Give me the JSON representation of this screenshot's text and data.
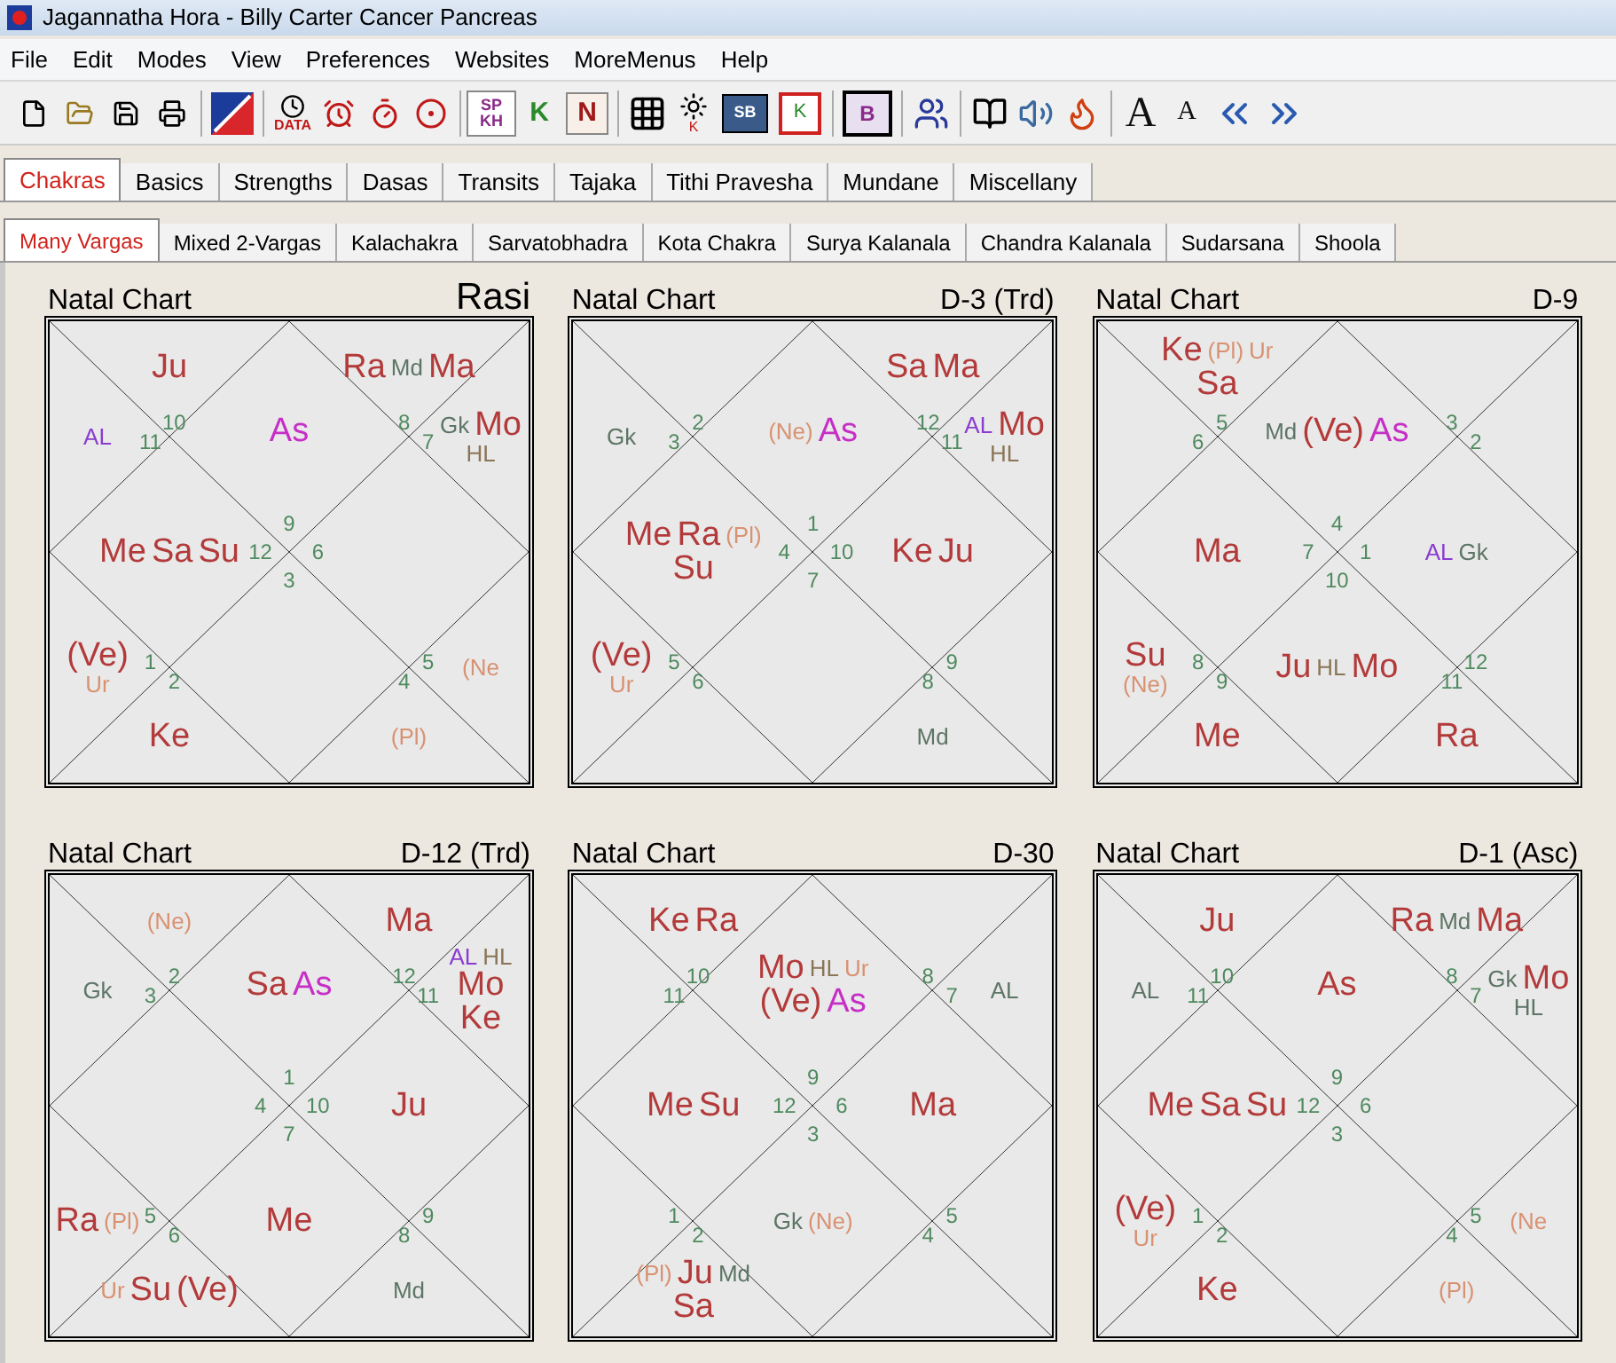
{
  "window": {
    "title": "Jagannatha Hora - Billy Carter Cancer Pancreas"
  },
  "menu": [
    "File",
    "Edit",
    "Modes",
    "View",
    "Preferences",
    "Websites",
    "MoreMenus",
    "Help"
  ],
  "toolbar_labels": {
    "data": "DATA",
    "sp": "SP",
    "kh": "KH",
    "key": "K",
    "n": "N",
    "star": "K",
    "sb": "SB",
    "box": "K",
    "b": "B",
    "a_large": "A",
    "a_small": "A"
  },
  "tabs": [
    {
      "label": "Chakras",
      "selected": true
    },
    {
      "label": "Basics",
      "selected": false
    },
    {
      "label": "Strengths",
      "selected": false
    },
    {
      "label": "Dasas",
      "selected": false
    },
    {
      "label": "Transits",
      "selected": false
    },
    {
      "label": "Tajaka",
      "selected": false
    },
    {
      "label": "Tithi Pravesha",
      "selected": false
    },
    {
      "label": "Mundane",
      "selected": false
    },
    {
      "label": "Miscellany",
      "selected": false
    }
  ],
  "subtabs": [
    {
      "label": "Many Vargas",
      "selected": true
    },
    {
      "label": "Mixed 2-Vargas",
      "selected": false
    },
    {
      "label": "Kalachakra",
      "selected": false
    },
    {
      "label": "Sarvatobhadra",
      "selected": false
    },
    {
      "label": "Kota Chakra",
      "selected": false
    },
    {
      "label": "Surya Kalanala",
      "selected": false
    },
    {
      "label": "Chandra Kalanala",
      "selected": false
    },
    {
      "label": "Sudarsana",
      "selected": false
    },
    {
      "label": "Shoola",
      "selected": false
    }
  ],
  "charts": [
    {
      "title": "Natal Chart",
      "varga": "Rasi",
      "houses": {
        "house_1": {
          "sign": "9",
          "planets": [
            {
              "name": "As",
              "kind": "lagna"
            }
          ]
        },
        "house_2": {
          "sign": "10",
          "planets": [
            {
              "name": "Ju",
              "kind": "graha"
            }
          ]
        },
        "house_3": {
          "sign": "11",
          "planets": [
            {
              "name": "AL",
              "kind": "arudha"
            }
          ]
        },
        "house_4": {
          "sign": "12",
          "planets": [
            {
              "name": "Me",
              "kind": "graha"
            },
            {
              "name": "Sa",
              "kind": "graha"
            },
            {
              "name": "Su",
              "kind": "graha"
            }
          ]
        },
        "house_5": {
          "sign": "1",
          "planets": [
            {
              "name": "(Ve)",
              "kind": "graha"
            },
            {
              "name": "Ur",
              "kind": "outer"
            }
          ]
        },
        "house_6": {
          "sign": "2",
          "planets": [
            {
              "name": "Ke",
              "kind": "graha"
            }
          ]
        },
        "house_7": {
          "sign": "3"
        },
        "house_8": {
          "sign": "4",
          "planets": [
            {
              "name": "(Pl)",
              "kind": "outer"
            }
          ]
        },
        "house_9": {
          "sign": "5",
          "planets": [
            {
              "name": "(Ne",
              "kind": "outer"
            }
          ]
        },
        "house_10": {
          "sign": "6"
        },
        "house_11": {
          "sign": "7",
          "planets": [
            {
              "name": "Gk",
              "kind": "upagraha"
            },
            {
              "name": "Mo",
              "kind": "graha"
            },
            {
              "name": "HL",
              "kind": "hora"
            }
          ]
        },
        "house_12": {
          "sign": "8",
          "planets": [
            {
              "name": "Ra",
              "kind": "graha"
            },
            {
              "name": "Md",
              "kind": "upagraha"
            },
            {
              "name": "Ma",
              "kind": "graha"
            }
          ]
        }
      }
    },
    {
      "title": "Natal Chart",
      "varga": "D-3 (Trd)",
      "houses": {
        "house_1": {
          "sign": "1",
          "planets": [
            {
              "name": "(Ne)",
              "kind": "outer"
            },
            {
              "name": "As",
              "kind": "lagna"
            }
          ]
        },
        "house_2": {
          "sign": "2"
        },
        "house_3": {
          "sign": "3",
          "planets": [
            {
              "name": "Gk",
              "kind": "upagraha"
            }
          ]
        },
        "house_4": {
          "sign": "4",
          "planets": [
            {
              "name": "Me",
              "kind": "graha"
            },
            {
              "name": "Ra",
              "kind": "graha"
            },
            {
              "name": "(Pl)",
              "kind": "outer"
            },
            {
              "name": "Su",
              "kind": "graha"
            }
          ]
        },
        "house_5": {
          "sign": "5",
          "planets": [
            {
              "name": "(Ve)",
              "kind": "graha"
            },
            {
              "name": "Ur",
              "kind": "outer"
            }
          ]
        },
        "house_6": {
          "sign": "6"
        },
        "house_7": {
          "sign": "7"
        },
        "house_8": {
          "sign": "8",
          "planets": [
            {
              "name": "Md",
              "kind": "upagraha"
            }
          ]
        },
        "house_9": {
          "sign": "9"
        },
        "house_10": {
          "sign": "10",
          "planets": [
            {
              "name": "Ke",
              "kind": "graha"
            },
            {
              "name": "Ju",
              "kind": "graha"
            }
          ]
        },
        "house_11": {
          "sign": "11",
          "planets": [
            {
              "name": "AL",
              "kind": "arudha"
            },
            {
              "name": "Mo",
              "kind": "graha"
            },
            {
              "name": "HL",
              "kind": "hora"
            }
          ]
        },
        "house_12": {
          "sign": "12",
          "planets": [
            {
              "name": "Sa",
              "kind": "graha"
            },
            {
              "name": "Ma",
              "kind": "graha"
            }
          ]
        }
      }
    },
    {
      "title": "Natal Chart",
      "varga": "D-9",
      "houses": {
        "house_1": {
          "sign": "4",
          "planets": [
            {
              "name": "Md",
              "kind": "upagraha"
            },
            {
              "name": "(Ve)",
              "kind": "graha"
            },
            {
              "name": "As",
              "kind": "lagna"
            }
          ]
        },
        "house_2": {
          "sign": "5",
          "planets": [
            {
              "name": "Ke",
              "kind": "graha"
            },
            {
              "name": "(Pl)",
              "kind": "outer"
            },
            {
              "name": "Ur",
              "kind": "outer"
            },
            {
              "name": "Sa",
              "kind": "graha"
            }
          ]
        },
        "house_3": {
          "sign": "6"
        },
        "house_4": {
          "sign": "7",
          "planets": [
            {
              "name": "Ma",
              "kind": "graha"
            }
          ]
        },
        "house_5": {
          "sign": "8",
          "planets": [
            {
              "name": "Su",
              "kind": "graha"
            },
            {
              "name": "(Ne)",
              "kind": "outer"
            }
          ]
        },
        "house_6": {
          "sign": "9",
          "planets": [
            {
              "name": "Me",
              "kind": "graha"
            }
          ]
        },
        "house_7": {
          "sign": "10",
          "planets": [
            {
              "name": "Ju",
              "kind": "graha"
            },
            {
              "name": "HL",
              "kind": "hora"
            },
            {
              "name": "Mo",
              "kind": "graha"
            }
          ]
        },
        "house_8": {
          "sign": "11",
          "planets": [
            {
              "name": "Ra",
              "kind": "graha"
            }
          ]
        },
        "house_9": {
          "sign": "12"
        },
        "house_10": {
          "sign": "1",
          "planets": [
            {
              "name": "AL",
              "kind": "arudha"
            },
            {
              "name": "Gk",
              "kind": "upagraha"
            }
          ]
        },
        "house_11": {
          "sign": "2"
        },
        "house_12": {
          "sign": "3"
        }
      }
    },
    {
      "title": "Natal Chart",
      "varga": "D-12 (Trd)",
      "houses": {
        "house_1": {
          "sign": "1",
          "planets": [
            {
              "name": "Sa",
              "kind": "graha"
            },
            {
              "name": "As",
              "kind": "lagna"
            }
          ]
        },
        "house_2": {
          "sign": "2",
          "planets": [
            {
              "name": "(Ne)",
              "kind": "outer"
            }
          ]
        },
        "house_3": {
          "sign": "3",
          "planets": [
            {
              "name": "Gk",
              "kind": "upagraha"
            }
          ]
        },
        "house_4": {
          "sign": "4"
        },
        "house_5": {
          "sign": "5",
          "planets": [
            {
              "name": "Ra",
              "kind": "graha"
            },
            {
              "name": "(Pl)",
              "kind": "outer"
            }
          ]
        },
        "house_6": {
          "sign": "6",
          "planets": [
            {
              "name": "Ur",
              "kind": "outer"
            },
            {
              "name": "Su",
              "kind": "graha"
            },
            {
              "name": "(Ve)",
              "kind": "graha"
            }
          ]
        },
        "house_7": {
          "sign": "7",
          "planets": [
            {
              "name": "Me",
              "kind": "graha"
            }
          ]
        },
        "house_8": {
          "sign": "8",
          "planets": [
            {
              "name": "Md",
              "kind": "upagraha"
            }
          ]
        },
        "house_9": {
          "sign": "9"
        },
        "house_10": {
          "sign": "10",
          "planets": [
            {
              "name": "Ju",
              "kind": "graha"
            }
          ]
        },
        "house_11": {
          "sign": "11",
          "planets": [
            {
              "name": "AL",
              "kind": "arudha"
            },
            {
              "name": "HL",
              "kind": "hora"
            },
            {
              "name": "Mo",
              "kind": "graha"
            },
            {
              "name": "Ke",
              "kind": "graha"
            }
          ]
        },
        "house_12": {
          "sign": "12",
          "planets": [
            {
              "name": "Ma",
              "kind": "graha"
            }
          ]
        }
      }
    },
    {
      "title": "Natal Chart",
      "varga": "D-30",
      "houses": {
        "house_1": {
          "sign": "9",
          "planets": [
            {
              "name": "Mo",
              "kind": "graha"
            },
            {
              "name": "HL",
              "kind": "hora"
            },
            {
              "name": "Ur",
              "kind": "outer"
            },
            {
              "name": "(Ve)",
              "kind": "graha"
            },
            {
              "name": "As",
              "kind": "lagna"
            }
          ]
        },
        "house_2": {
          "sign": "10",
          "planets": [
            {
              "name": "Ke",
              "kind": "graha"
            },
            {
              "name": "Ra",
              "kind": "graha"
            }
          ]
        },
        "house_3": {
          "sign": "11"
        },
        "house_4": {
          "sign": "12",
          "planets": [
            {
              "name": "Me",
              "kind": "graha"
            },
            {
              "name": "Su",
              "kind": "graha"
            }
          ]
        },
        "house_5": {
          "sign": "1"
        },
        "house_6": {
          "sign": "2",
          "planets": [
            {
              "name": "(Pl)",
              "kind": "outer"
            },
            {
              "name": "Ju",
              "kind": "graha"
            },
            {
              "name": "Md",
              "kind": "upagraha"
            },
            {
              "name": "Sa",
              "kind": "graha"
            }
          ]
        },
        "house_7": {
          "sign": "3",
          "planets": [
            {
              "name": "Gk",
              "kind": "upagraha"
            },
            {
              "name": "(Ne)",
              "kind": "outer"
            }
          ]
        },
        "house_8": {
          "sign": "4"
        },
        "house_9": {
          "sign": "5"
        },
        "house_10": {
          "sign": "6",
          "planets": [
            {
              "name": "Ma",
              "kind": "graha"
            }
          ]
        },
        "house_11": {
          "sign": "7",
          "planets": [
            {
              "name": "AL",
              "kind": "upagraha"
            }
          ]
        },
        "house_12": {
          "sign": "8"
        }
      }
    },
    {
      "title": "Natal Chart",
      "varga": "D-1 (Asc)",
      "houses": {
        "house_1": {
          "sign": "9",
          "planets": [
            {
              "name": "As",
              "kind": "graha"
            }
          ]
        },
        "house_2": {
          "sign": "10",
          "planets": [
            {
              "name": "Ju",
              "kind": "graha"
            }
          ]
        },
        "house_3": {
          "sign": "11",
          "planets": [
            {
              "name": "AL",
              "kind": "upagraha"
            }
          ]
        },
        "house_4": {
          "sign": "12",
          "planets": [
            {
              "name": "Me",
              "kind": "graha"
            },
            {
              "name": "Sa",
              "kind": "graha"
            },
            {
              "name": "Su",
              "kind": "graha"
            }
          ]
        },
        "house_5": {
          "sign": "1",
          "planets": [
            {
              "name": "(Ve)",
              "kind": "graha"
            },
            {
              "name": "Ur",
              "kind": "outer"
            }
          ]
        },
        "house_6": {
          "sign": "2",
          "planets": [
            {
              "name": "Ke",
              "kind": "graha"
            }
          ]
        },
        "house_7": {
          "sign": "3"
        },
        "house_8": {
          "sign": "4",
          "planets": [
            {
              "name": "(Pl)",
              "kind": "outer"
            }
          ]
        },
        "house_9": {
          "sign": "5",
          "planets": [
            {
              "name": "(Ne",
              "kind": "outer"
            }
          ]
        },
        "house_10": {
          "sign": "6"
        },
        "house_11": {
          "sign": "7",
          "planets": [
            {
              "name": "Gk",
              "kind": "upagraha"
            },
            {
              "name": "Mo",
              "kind": "graha"
            },
            {
              "name": "HL",
              "kind": "upagraha"
            }
          ]
        },
        "house_12": {
          "sign": "8",
          "planets": [
            {
              "name": "Ra",
              "kind": "graha"
            },
            {
              "name": "Md",
              "kind": "upagraha"
            },
            {
              "name": "Ma",
              "kind": "graha"
            }
          ]
        }
      }
    }
  ]
}
